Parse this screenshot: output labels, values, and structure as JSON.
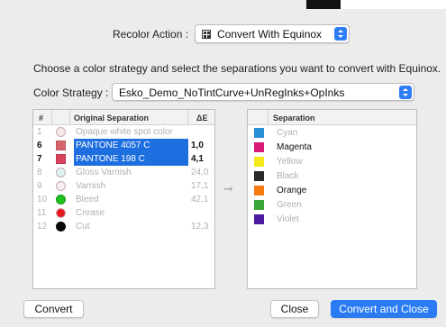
{
  "header": {
    "recolor_label": "Recolor Action :",
    "action_value": "Convert With Equinox"
  },
  "instruction": "Choose a color strategy and select the separations you want to convert with Equinox.",
  "strategy": {
    "label": "Color Strategy :",
    "value": "Esko_Demo_NoTintCurve+UnRegInks+OpInks"
  },
  "left_table": {
    "headers": {
      "num": "#",
      "name": "Original Separation",
      "de": "ΔE"
    },
    "rows": [
      {
        "num": "1",
        "name": "Opaque white spot color",
        "de": "",
        "color": "#f4eaea",
        "shape": "circle",
        "state": "dim"
      },
      {
        "num": "6",
        "name": "PANTONE 4057 C",
        "de": "1,0",
        "color": "#d9646e",
        "shape": "square",
        "state": "active"
      },
      {
        "num": "7",
        "name": "PANTONE 198 C",
        "de": "4,1",
        "color": "#d8435e",
        "shape": "square",
        "state": "active"
      },
      {
        "num": "8",
        "name": "Gloss Varnish",
        "de": "24,0",
        "color": "#dbf3f5",
        "shape": "circle",
        "state": "dim"
      },
      {
        "num": "9",
        "name": "Varnish",
        "de": "17,1",
        "color": "#f7eef1",
        "shape": "circle",
        "state": "dim"
      },
      {
        "num": "10",
        "name": "Bleed",
        "de": "42,1",
        "color": "#1fc21f",
        "shape": "circle",
        "state": "dim"
      },
      {
        "num": "11",
        "name": "Crease",
        "de": "",
        "color": "#e8161f",
        "shape": "circle",
        "state": "dim"
      },
      {
        "num": "12",
        "name": "Cut",
        "de": "12,3",
        "color": "#0a0a0a",
        "shape": "circle",
        "state": "dim"
      }
    ]
  },
  "right_table": {
    "header": "Separation",
    "rows": [
      {
        "name": "Cyan",
        "color": "#2a8fd6",
        "state": "dim"
      },
      {
        "name": "Magenta",
        "color": "#d81b78",
        "state": "active"
      },
      {
        "name": "Yellow",
        "color": "#f2e81c",
        "state": "dim"
      },
      {
        "name": "Black",
        "color": "#2a2a2a",
        "state": "dim"
      },
      {
        "name": "Orange",
        "color": "#f57a10",
        "state": "active"
      },
      {
        "name": "Green",
        "color": "#3ba43a",
        "state": "dim"
      },
      {
        "name": "Violet",
        "color": "#4b1aa0",
        "state": "dim"
      }
    ]
  },
  "buttons": {
    "convert": "Convert",
    "close": "Close",
    "convert_close": "Convert and Close"
  }
}
